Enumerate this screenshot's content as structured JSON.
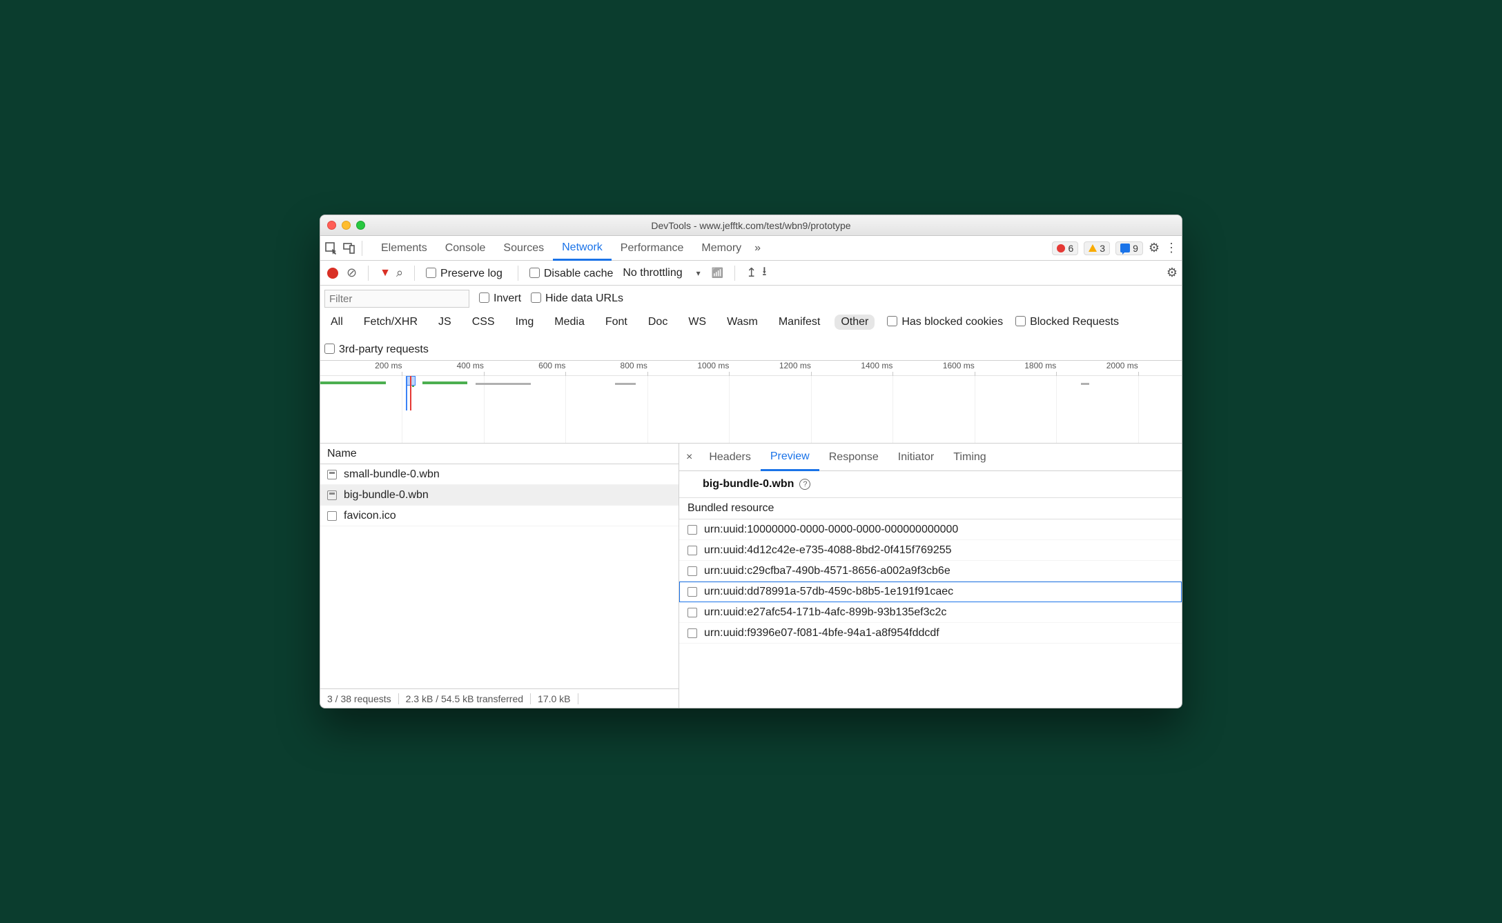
{
  "window": {
    "title": "DevTools - www.jefftk.com/test/wbn9/prototype"
  },
  "panels": {
    "tabs": [
      "Elements",
      "Console",
      "Sources",
      "Network",
      "Performance",
      "Memory"
    ],
    "active": "Network",
    "counters": {
      "errors": "6",
      "warnings": "3",
      "messages": "9"
    }
  },
  "network_toolbar": {
    "preserve_log": "Preserve log",
    "disable_cache": "Disable cache",
    "throttling": "No throttling"
  },
  "filter_bar": {
    "placeholder": "Filter",
    "invert": "Invert",
    "hide_data_urls": "Hide data URLs",
    "types": [
      "All",
      "Fetch/XHR",
      "JS",
      "CSS",
      "Img",
      "Media",
      "Font",
      "Doc",
      "WS",
      "Wasm",
      "Manifest",
      "Other"
    ],
    "selected_type": "Other",
    "has_blocked_cookies": "Has blocked cookies",
    "blocked_requests": "Blocked Requests",
    "third_party": "3rd-party requests"
  },
  "timeline": {
    "ticks": [
      "200 ms",
      "400 ms",
      "600 ms",
      "800 ms",
      "1000 ms",
      "1200 ms",
      "1400 ms",
      "1600 ms",
      "1800 ms",
      "2000 ms"
    ]
  },
  "columns": {
    "name": "Name"
  },
  "requests": [
    {
      "name": "small-bundle-0.wbn",
      "selected": false
    },
    {
      "name": "big-bundle-0.wbn",
      "selected": true
    },
    {
      "name": "favicon.ico",
      "selected": false,
      "empty": true
    }
  ],
  "status": {
    "count": "3 / 38 requests",
    "transferred": "2.3 kB / 54.5 kB transferred",
    "resources": "17.0 kB "
  },
  "detail": {
    "tabs": [
      "Headers",
      "Preview",
      "Response",
      "Initiator",
      "Timing"
    ],
    "active": "Preview",
    "title": "big-bundle-0.wbn",
    "section": "Bundled resource",
    "resources": [
      "urn:uuid:10000000-0000-0000-0000-000000000000",
      "urn:uuid:4d12c42e-e735-4088-8bd2-0f415f769255",
      "urn:uuid:c29cfba7-490b-4571-8656-a002a9f3cb6e",
      "urn:uuid:dd78991a-57db-459c-b8b5-1e191f91caec",
      "urn:uuid:e27afc54-171b-4afc-899b-93b135ef3c2c",
      "urn:uuid:f9396e07-f081-4bfe-94a1-a8f954fddcdf"
    ],
    "selected_resource_index": 3
  }
}
